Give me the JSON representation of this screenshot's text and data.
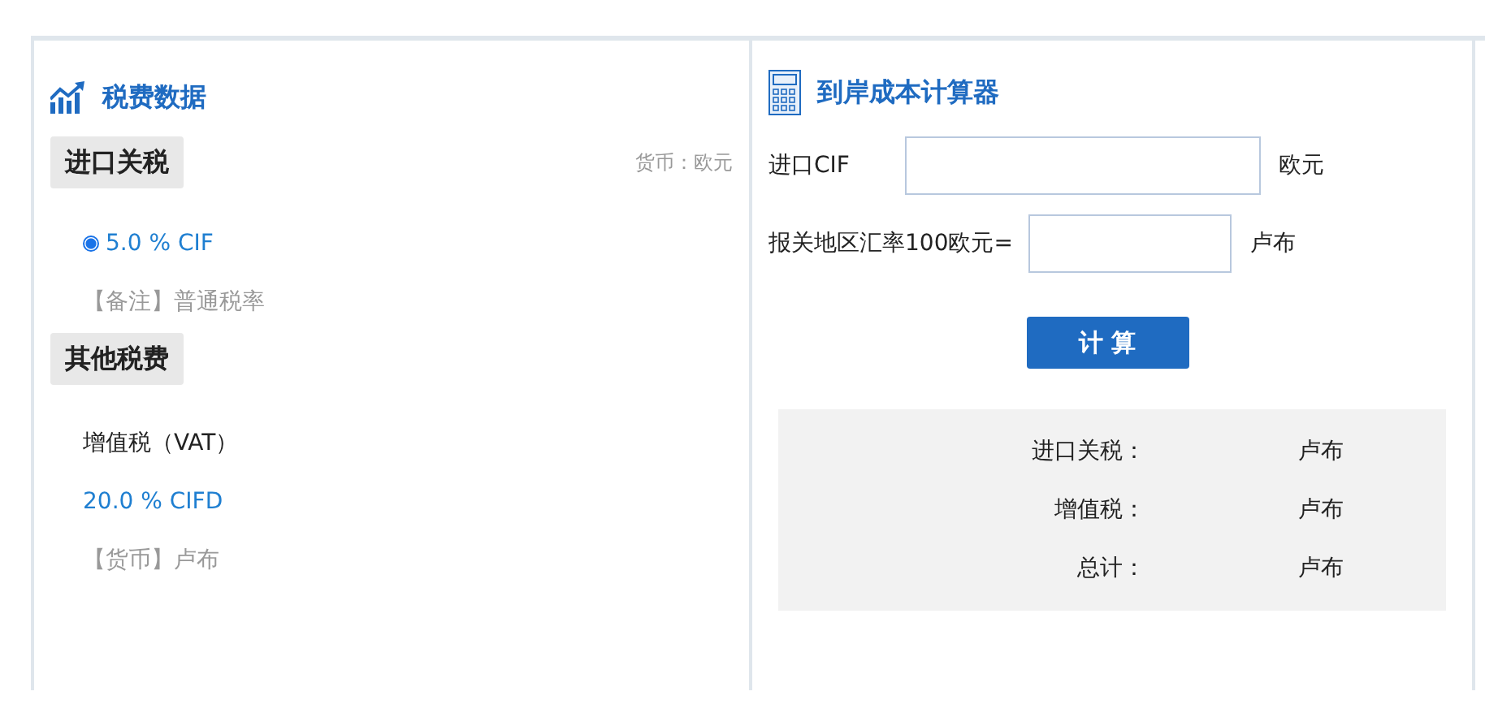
{
  "tariff_panel": {
    "title": "税费数据",
    "import_duty": {
      "heading": "进口关税",
      "currency_note": "货币：欧元",
      "rates": [
        {
          "label": "5.0 % CIF",
          "selected": true
        }
      ],
      "remark": "【备注】普通税率"
    },
    "other_taxes": {
      "heading": "其他税费",
      "items": [
        {
          "name": "增值税（VAT）",
          "rate": "20.0 % CIFD",
          "currency": "【货币】卢布"
        }
      ]
    }
  },
  "calculator": {
    "title": "到岸成本计算器",
    "fields": [
      {
        "label": "进口CIF",
        "unit": "欧元",
        "kind": "wide"
      },
      {
        "label": "报关地区汇率100欧元=",
        "unit": "卢布",
        "kind": "narrow"
      }
    ],
    "button": "计 算",
    "results": [
      {
        "label": "进口关税：",
        "unit": "卢布"
      },
      {
        "label": "增值税：",
        "unit": "卢布"
      },
      {
        "label": "总计：",
        "unit": "卢布"
      }
    ]
  }
}
